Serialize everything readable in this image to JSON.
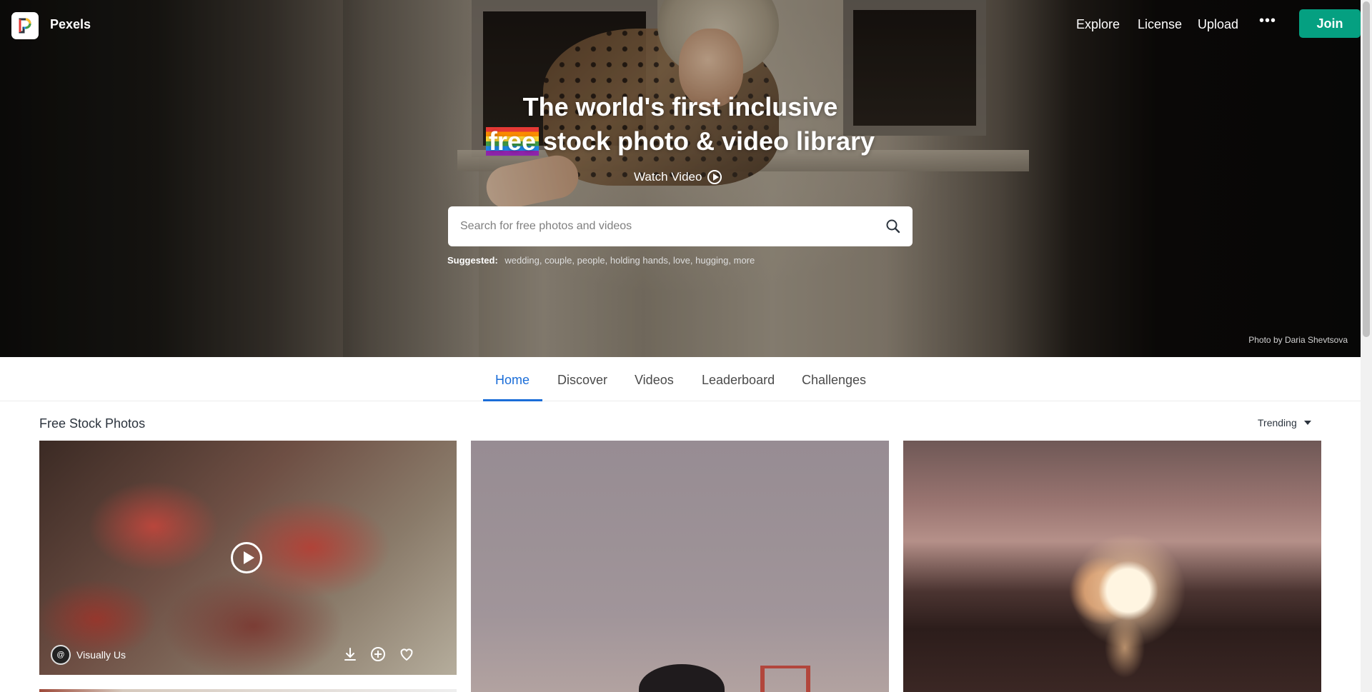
{
  "brand": {
    "name": "Pexels"
  },
  "nav": {
    "explore": "Explore",
    "license": "License",
    "upload": "Upload",
    "more": "•••",
    "join": "Join"
  },
  "hero": {
    "line1": "The world's first inclusive",
    "free": "free",
    "line2_rest": "stock photo & video library",
    "watch_video": "Watch Video",
    "search_placeholder": "Search for free photos and videos",
    "suggested_label": "Suggested:",
    "suggested_tags": "wedding, couple, people, holding hands, love, hugging, more",
    "credit": "Photo by Daria Shevtsova"
  },
  "tabs": [
    {
      "label": "Home",
      "active": true
    },
    {
      "label": "Discover"
    },
    {
      "label": "Videos"
    },
    {
      "label": "Leaderboard"
    },
    {
      "label": "Challenges"
    }
  ],
  "feed": {
    "title": "Free Stock Photos",
    "sort": "Trending",
    "items": [
      {
        "author": "Visually Us",
        "type": "video"
      }
    ]
  },
  "colors": {
    "accent": "#05a081",
    "tab_active": "#1a6dd8"
  }
}
